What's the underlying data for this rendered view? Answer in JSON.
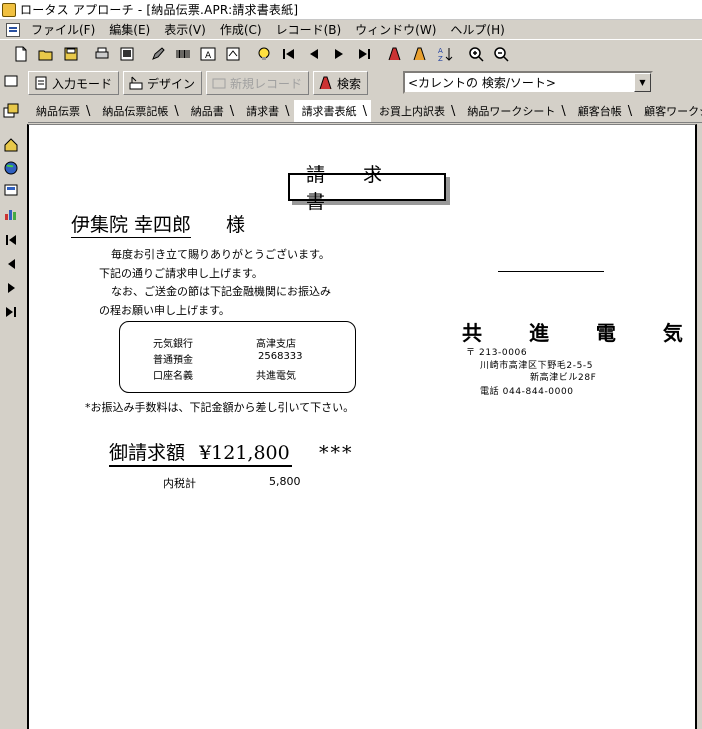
{
  "window": {
    "title": "ロータス アプローチ - [納品伝票.APR:請求書表紙]"
  },
  "menu": {
    "items": [
      "ファイル(F)",
      "編集(E)",
      "表示(V)",
      "作成(C)",
      "レコード(B)",
      "ウィンドウ(W)",
      "ヘルプ(H)"
    ]
  },
  "toolbar2": {
    "input_mode": "入力モード",
    "design": "デザイン",
    "new_record": "新規レコード",
    "search": "検索",
    "combo_value": "<カレントの 検索/ソート>"
  },
  "tabs": [
    "納品伝票",
    "納品伝票記帳",
    "納品書",
    "請求書",
    "請求書表紙",
    "お買上内訳表",
    "納品ワークシート",
    "顧客台帳",
    "顧客ワークシート"
  ],
  "invoice": {
    "title": "請 求 書",
    "customer_name": "伊集院 幸四郎",
    "honorific": "様",
    "message_lines": [
      "毎度お引き立て賜りありがとうございます。",
      "下記の通りご請求申し上げます。",
      "なお、ご送金の節は下記金融機関にお振込み",
      "の程お願い申し上げます。"
    ],
    "bank": {
      "bank_name": "元気銀行",
      "branch": "高津支店",
      "account_type": "普通預金",
      "account_number": "2568333",
      "holder_label": "口座名義",
      "holder": "共進電気"
    },
    "fee_note": "*お振込み手数料は、下記金額から差し引いて下さい。",
    "amount_label": "御請求額",
    "amount": "¥121,800",
    "amount_stars": "***",
    "tax_label": "内税計",
    "tax_value": "5,800",
    "company": {
      "name": "共 進 電 気",
      "postal": "〒 213-0006",
      "address1": "川崎市高津区下野毛2-5-5",
      "address2": "新高津ビル28F",
      "phone": "電話 044-844-0000"
    }
  }
}
